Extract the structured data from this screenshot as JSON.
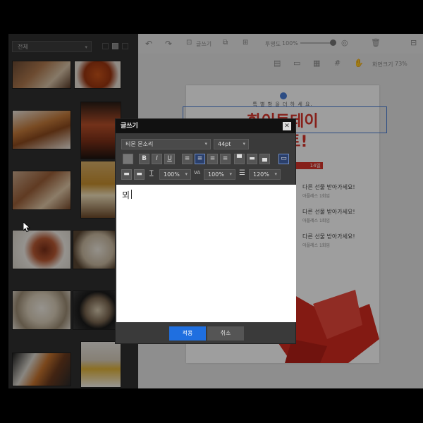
{
  "left_panel": {
    "category": "전체",
    "images": [
      "meat-platter",
      "spicy-chicken",
      "grilled-chicken",
      "chicken-skewers",
      "pork-chop",
      "beer-glass",
      "spicy-noodle",
      "white-noodle",
      "pho-bowl",
      "noodle-pot",
      "lunchbox",
      "drink-bottles"
    ]
  },
  "toolbar": {
    "text_label": "글쓰기",
    "opacity_label": "투명도",
    "opacity_value": "100%",
    "zoom_label": "화면크기",
    "zoom_value": "73%"
  },
  "poster": {
    "top_line": "특 별 함 을 더 하 세 요.",
    "headline1": "화이트데이",
    "headline2": "이벤트!",
    "badge": "14일",
    "events": [
      {
        "line": "다른 선물 받아가세요!",
        "sub": "아플레스 1회입"
      },
      {
        "line": "다른 선물 받아가세요!",
        "sub": "아플레스 1회입"
      },
      {
        "line": "다른 선물 받아가세요!",
        "sub": "아플레스 1회입"
      }
    ]
  },
  "dialog": {
    "title": "글쓰기",
    "close": "✕",
    "font_name": "티몬 몬소리",
    "font_size": "44pt",
    "scale_x": "100%",
    "spacing": "100%",
    "line_height": "120%",
    "editor_text": "뫼",
    "apply": "적용",
    "cancel": "취소"
  }
}
